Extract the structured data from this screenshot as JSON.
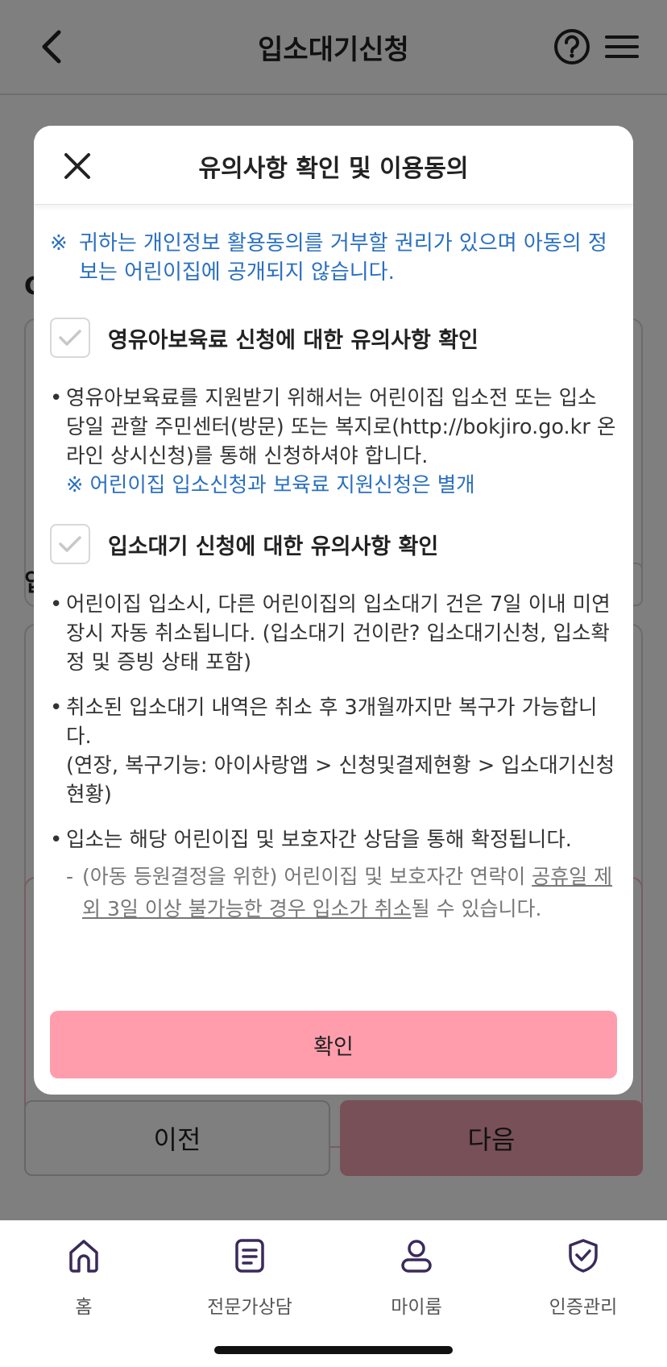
{
  "header": {
    "title": "입소대기신청"
  },
  "background": {
    "letter_1": "C",
    "letter_2": "입",
    "prev_label": "이전",
    "next_label": "다음"
  },
  "modal": {
    "title": "유의사항 확인 및 이용동의",
    "notice_mark": "※",
    "notice_text": "귀하는 개인정보 활용동의를 거부할 권리가 있으며 아동의 정보는 어린이집에 공개되지 않습니다.",
    "section1": {
      "label": "영유아보육료 신청에 대한 유의사항 확인",
      "bullets": [
        "영유아보육료를 지원받기 위해서는 어린이집 입소전 또는 입소 당일 관할 주민센터(방문) 또는 복지로(http://bokjiro.go.kr 온라인 상시신청)를 통해 신청하셔야 합니다."
      ],
      "note": "※ 어린이집 입소신청과 보육료 지원신청은 별개"
    },
    "section2": {
      "label": "입소대기 신청에 대한 유의사항 확인",
      "bullets": [
        "어린이집 입소시, 다른 어린이집의 입소대기 건은 7일 이내 미연장시 자동 취소됩니다. (입소대기 건이란? 입소대기신청, 입소확정 및 증빙 상태 포함)",
        "취소된 입소대기 내역은 취소 후 3개월까지만 복구가 가능합니다.",
        "입소는 해당 어린이집 및 보호자간 상담을 통해 확정됩니다."
      ],
      "bullet2_extra": "(연장, 복구기능: 아이사랑앱 > 신청및결제현황 > 입소대기신청현황)",
      "sub_prefix": "(아동 등원결정을 위한) 어린이집 및 보호자간 연락이 ",
      "sub_underlined": "공휴일 제외 3일 이상 불가능한 경우 입소가 취소",
      "sub_suffix": "될 수 있습니다."
    },
    "confirm_label": "확인"
  },
  "bottom_nav": {
    "items": [
      {
        "label": "홈",
        "icon": "home-icon"
      },
      {
        "label": "전문가상담",
        "icon": "document-icon"
      },
      {
        "label": "마이룸",
        "icon": "person-icon"
      },
      {
        "label": "인증관리",
        "icon": "shield-check-icon"
      }
    ]
  },
  "colors": {
    "accent_pink": "#ff9dad",
    "notice_blue": "#2a6fbf",
    "nav_icon": "#3a2a5a"
  }
}
